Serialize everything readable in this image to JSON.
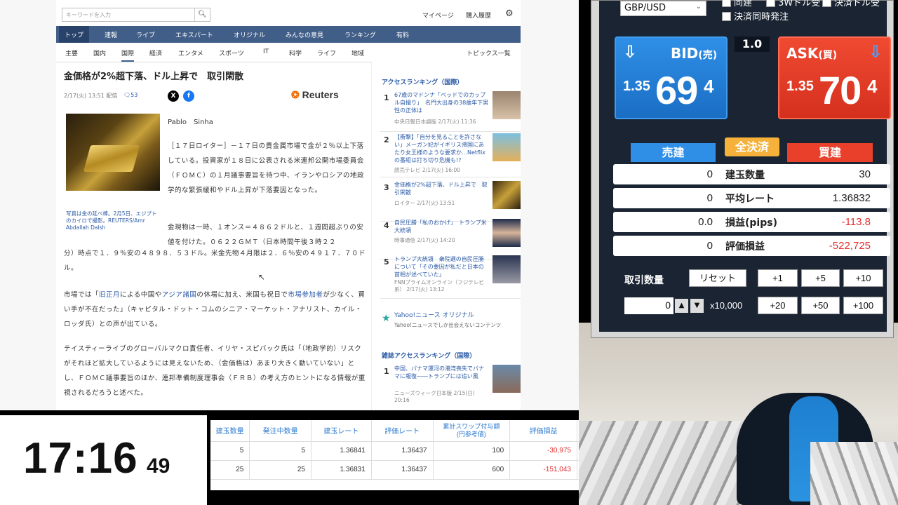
{
  "news": {
    "search_placeholder": "キーワードを入力",
    "top_links": [
      "マイページ",
      "購入履歴"
    ],
    "main_nav": [
      "トップ",
      "速報",
      "ライブ",
      "エキスパート",
      "オリジナル",
      "みんなの意見",
      "ランキング",
      "有料"
    ],
    "sub_nav": [
      "主要",
      "国内",
      "国際",
      "経済",
      "エンタメ",
      "スポーツ",
      "IT",
      "科学",
      "ライフ",
      "地域"
    ],
    "topics_link": "トピックス一覧",
    "headline": "金価格が2%超下落、ドル上昇で　取引閑散",
    "date": "2/17(火) 13:51 配信",
    "comments": "53",
    "publisher": "Reuters",
    "author": "Pablo　Sinha",
    "photo_caption": "写真は金の延べ棒。2月5日、エジプトのカイロで撮影。REUTERS/Amr Abdallah Dalsh",
    "paragraphs": {
      "p1": "［１７日ロイター］－１７日の貴金属市場で金が２％以上下落している。投資家が１８日に公表される米連邦公開市場委員会（ＦＯＭＣ）の１月議事要旨を待つ中、イランやロシアの地政学的な緊張緩和やドル上昇が下落要因となった。",
      "p2a": "金現物は一時、１オンス＝４８６２ドルと、１週間超ぶりの安値を付けた。０６２２ＧＭＴ（日本時間午後３時２２",
      "p2b": "分）時点で１．９％安の４８９８．５３ドル。米金先物４月限は２．６％安の４９１７．７０ドル。",
      "p3_pre": "市場では「",
      "p3_link1": "旧正月",
      "p3_mid1": "による中国や",
      "p3_link2": "アジア諸国",
      "p3_mid2": "の休場に加え、米国も祝日で",
      "p3_link3": "市場参加者",
      "p3_post": "が少なく、買い手が不在だった」（キャピタル・ドット・コムのシニア・マーケット・アナリスト、カイル・ロッダ氏）との声が出ている。",
      "p4": "テイスティーライブのグローバルマクロ責任者、イリヤ・スピバック氏は「（地政学的）リスクがそれほど拡大しているようには見えないため、（金価格は）あまり大きく動いていない」とし、ＦＯＭＣ議事要旨のほか、連邦準備制度理事会（ＦＲＢ）の考え方のヒントになる情報が重視されるだろうと述べた。"
    },
    "ranking_title": "アクセスランキング（国際）",
    "ranking": [
      {
        "num": "1",
        "title": "67歳のマドンナ「ベッドでのカップル自撮り」　名門大出身の38歳年下男性の正体は",
        "source": "中央日報日本語版 2/17(火) 11:36"
      },
      {
        "num": "2",
        "title": "【衝撃】「自分を見ることを許さない」メーガン妃がイギリス帰国にあたり女王様のような要求か…Netflixの番組は打ち切り危機も!?",
        "source": "読売テレビ 2/17(火) 16:00"
      },
      {
        "num": "3",
        "title": "金価格が2%超下落、ドル上昇で　取引閑散",
        "source": "ロイター 2/17(火) 13:51"
      },
      {
        "num": "4",
        "title": "自民圧勝「私のおかげ」　トランプ米大統領",
        "source": "時事通信 2/17(火) 14:20"
      },
      {
        "num": "5",
        "title": "トランプ大統領　衆院選の自民圧勝について「その要因が私だと日本の首相が述べていた」",
        "source": "FNNプライムオンライン（フジテレビ系） 2/17(火) 13:12"
      }
    ],
    "yahoo_original_title": "Yahoo!ニュース オリジナル",
    "yahoo_original_sub": "Yahoo!ニュースでしか出会えないコンテンツ",
    "magazine_title": "雑誌アクセスランキング（国際）",
    "magazine": [
      {
        "num": "1",
        "title": "中国、パナマ運河の港湾喪失でパナマに報復――トランプには追い風",
        "source": "ニューズウィーク日本版 2/15(日) 20:16"
      }
    ]
  },
  "timer": {
    "hhmm": "17:16",
    "ss": "49"
  },
  "positions": {
    "headers": [
      "建玉数量",
      "発注中数量",
      "建玉レート",
      "評価レート",
      "累計スワップ付与額\n(円参考値)",
      "評価損益"
    ],
    "rows": [
      [
        "5",
        "5",
        "1.36841",
        "1.36437",
        "100",
        "-30,975"
      ],
      [
        "25",
        "25",
        "1.36831",
        "1.36437",
        "600",
        "-151,043"
      ]
    ]
  },
  "panel": {
    "pair": "GBP/USD",
    "checks": [
      "同建",
      "3Wドル受",
      "決済ドル受",
      "決済同時発注"
    ],
    "bid_label": "BID",
    "bid_suffix": "(売)",
    "ask_label": "ASK",
    "ask_suffix": "(買)",
    "bid_pre": "1.35",
    "bid_big": "69",
    "bid_sup": "4",
    "ask_pre": "1.35",
    "ask_big": "70",
    "ask_sup": "4",
    "spread": "1.0",
    "sell_tab": "売建",
    "close_all": "全決済",
    "buy_tab": "買建",
    "rows": [
      {
        "left": "0",
        "label": "建玉数量",
        "right": "30"
      },
      {
        "left": "0",
        "label": "平均レート",
        "right": "1.36832"
      },
      {
        "left": "0.0",
        "label": "損益(pips)",
        "right": "-113.8"
      },
      {
        "left": "0",
        "label": "評価損益",
        "right": "-522,725"
      }
    ],
    "qty_label": "取引数量",
    "reset": "リセット",
    "inc_buttons": [
      "+1",
      "+5",
      "+10",
      "+20",
      "+50",
      "+100"
    ],
    "qty_value": "0",
    "multiplier": "x10,000",
    "colors": {
      "bid": "#1a6ec4",
      "ask": "#d4301e",
      "loss": "#e23030"
    }
  }
}
